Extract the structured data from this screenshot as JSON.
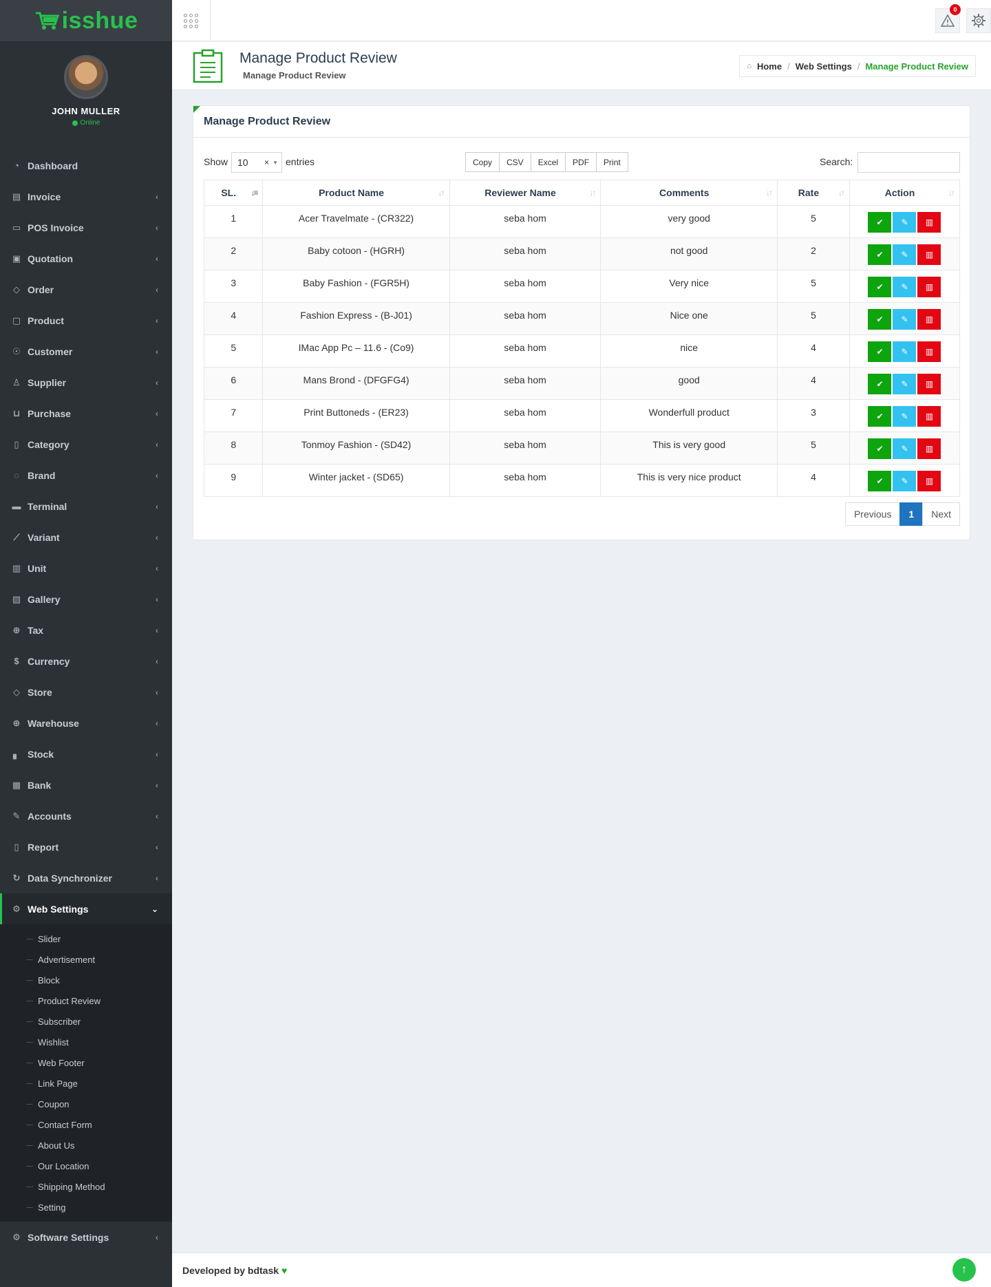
{
  "app": {
    "logo_text": "isshue",
    "brand_color": "#27c24c"
  },
  "profile": {
    "name": "JOHN MULLER",
    "status": "Online"
  },
  "sidebar": {
    "items": [
      {
        "label": "Dashboard",
        "icon": "speedometer-icon",
        "glyph": "◔"
      },
      {
        "label": "Invoice",
        "icon": "invoice-icon",
        "glyph": "▤"
      },
      {
        "label": "POS Invoice",
        "icon": "pos-icon",
        "glyph": "▭"
      },
      {
        "label": "Quotation",
        "icon": "clipboard-icon",
        "glyph": "▣"
      },
      {
        "label": "Order",
        "icon": "tag-icon",
        "glyph": "◇"
      },
      {
        "label": "Product",
        "icon": "bag-icon",
        "glyph": "▢"
      },
      {
        "label": "Customer",
        "icon": "handshake-icon",
        "glyph": "☉"
      },
      {
        "label": "Supplier",
        "icon": "user-icon",
        "glyph": "♙"
      },
      {
        "label": "Purchase",
        "icon": "cart-icon",
        "glyph": "⊔"
      },
      {
        "label": "Category",
        "icon": "bookmark-icon",
        "glyph": "▯"
      },
      {
        "label": "Brand",
        "icon": "apple-icon",
        "glyph": "◌"
      },
      {
        "label": "Terminal",
        "icon": "credit-card-icon",
        "glyph": "▬"
      },
      {
        "label": "Variant",
        "icon": "wand-icon",
        "glyph": "⟋"
      },
      {
        "label": "Unit",
        "icon": "columns-icon",
        "glyph": "▥"
      },
      {
        "label": "Gallery",
        "icon": "image-icon",
        "glyph": "▨"
      },
      {
        "label": "Tax",
        "icon": "target-icon",
        "glyph": "⊕"
      },
      {
        "label": "Currency",
        "icon": "dollar-icon",
        "glyph": "$"
      },
      {
        "label": "Store",
        "icon": "store-tag-icon",
        "glyph": "◇"
      },
      {
        "label": "Warehouse",
        "icon": "crosshair-icon",
        "glyph": "⊕"
      },
      {
        "label": "Stock",
        "icon": "bar-chart-icon",
        "glyph": "▖"
      },
      {
        "label": "Bank",
        "icon": "bank-icon",
        "glyph": "▦"
      },
      {
        "label": "Accounts",
        "icon": "edit-icon",
        "glyph": "✎"
      },
      {
        "label": "Report",
        "icon": "book-icon",
        "glyph": "▯"
      },
      {
        "label": "Data Synchronizer",
        "icon": "sync-icon",
        "glyph": "↻"
      }
    ],
    "active": {
      "label": "Web Settings",
      "icon": "gear-icon",
      "glyph": "⚙"
    },
    "sub_items": [
      "Slider",
      "Advertisement",
      "Block",
      "Product Review",
      "Subscriber",
      "Wishlist",
      "Web Footer",
      "Link Page",
      "Coupon",
      "Contact Form",
      "About Us",
      "Our Location",
      "Shipping Method",
      "Setting"
    ],
    "last": {
      "label": "Software Settings",
      "icon": "gear-icon",
      "glyph": "⚙"
    }
  },
  "topbar": {
    "notification_count": "0"
  },
  "header": {
    "title": "Manage Product Review",
    "subtitle": "Manage Product Review",
    "breadcrumb": {
      "home": "Home",
      "section": "Web Settings",
      "current": "Manage Product Review"
    }
  },
  "panel": {
    "title": "Manage Product Review",
    "show_label": "Show",
    "entries_value": "10",
    "entries_label": "entries",
    "buttons": [
      "Copy",
      "CSV",
      "Excel",
      "PDF",
      "Print"
    ],
    "search_label": "Search:",
    "search_value": ""
  },
  "table": {
    "columns": [
      "SL.",
      "Product Name",
      "Reviewer Name",
      "Comments",
      "Rate",
      "Action"
    ],
    "rows": [
      {
        "sl": "1",
        "product": "Acer Travelmate - (CR322)",
        "reviewer": "seba hom",
        "comment": "very good",
        "rate": "5"
      },
      {
        "sl": "2",
        "product": "Baby cotoon - (HGRH)",
        "reviewer": "seba hom",
        "comment": "not good",
        "rate": "2"
      },
      {
        "sl": "3",
        "product": "Baby Fashion - (FGR5H)",
        "reviewer": "seba hom",
        "comment": "Very nice",
        "rate": "5"
      },
      {
        "sl": "4",
        "product": "Fashion Express - (B-J01)",
        "reviewer": "seba hom",
        "comment": "Nice one",
        "rate": "5"
      },
      {
        "sl": "5",
        "product": "IMac App Pc – 11.6 - (Co9)",
        "reviewer": "seba hom",
        "comment": "nice",
        "rate": "4"
      },
      {
        "sl": "6",
        "product": "Mans Brond - (DFGFG4)",
        "reviewer": "seba hom",
        "comment": "good",
        "rate": "4"
      },
      {
        "sl": "7",
        "product": "Print Buttoneds - (ER23)",
        "reviewer": "seba hom",
        "comment": "Wonderfull product",
        "rate": "3"
      },
      {
        "sl": "8",
        "product": "Tonmoy Fashion - (SD42)",
        "reviewer": "seba hom",
        "comment": "This is very good",
        "rate": "5"
      },
      {
        "sl": "9",
        "product": "Winter jacket - (SD65)",
        "reviewer": "seba hom",
        "comment": "This is very nice product",
        "rate": "4"
      }
    ]
  },
  "pagination": {
    "previous": "Previous",
    "current": "1",
    "next": "Next"
  },
  "footer": {
    "text": "Developed by bdtask"
  }
}
